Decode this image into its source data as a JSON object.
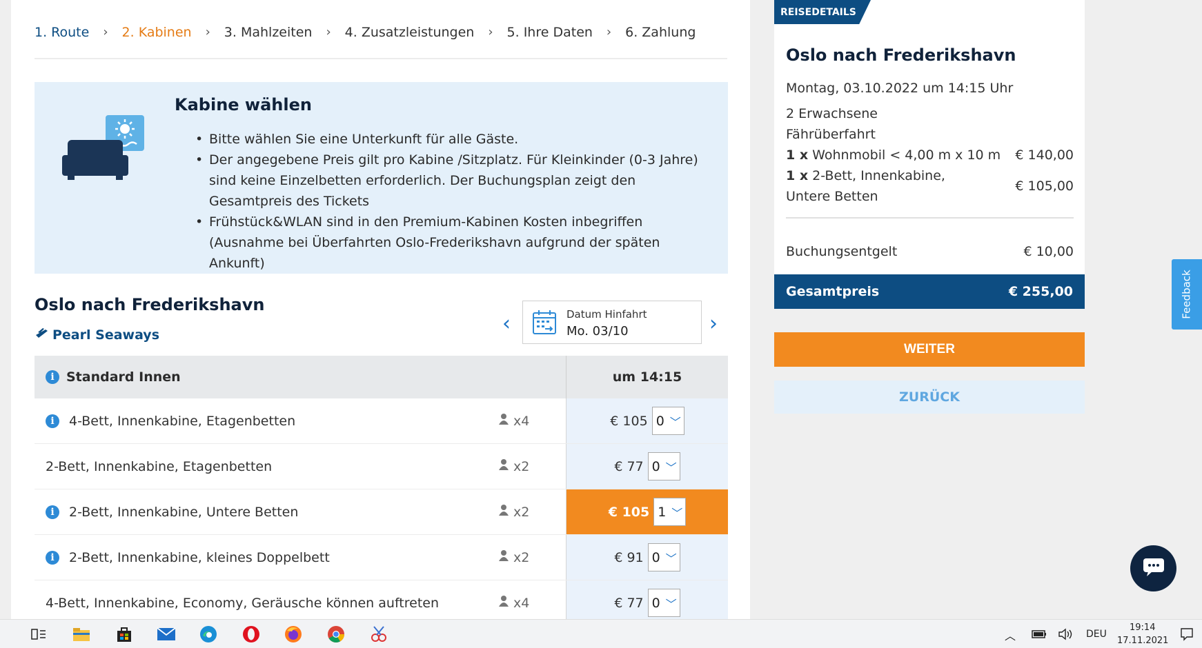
{
  "breadcrumb": [
    "1. Route",
    "2. Kabinen",
    "3. Mahlzeiten",
    "4. Zusatzleistungen",
    "5. Ihre Daten",
    "6. Zahlung"
  ],
  "info": {
    "title": "Kabine wählen",
    "bullets": [
      "Bitte wählen Sie eine Unterkunft für alle Gäste.",
      "Der angegebene Preis gilt pro Kabine /Sitzplatz. Für Kleinkinder (0-3 Jahre) sind keine Einzelbetten erforderlich. Der Buchungsplan zeigt den Gesamtpreis des Tickets",
      "Frühstück&WLAN sind in den Premium-Kabinen Kosten inbegriffen (Ausnahme bei Überfahrten Oslo-Frederikshavn aufgrund der späten Ankunft)"
    ]
  },
  "route": {
    "title": "Oslo nach Frederikshavn",
    "ship": "Pearl Seaways",
    "date_label": "Datum Hinfahrt",
    "date_value": "Mo. 03/10"
  },
  "table": {
    "category": "Standard Innen",
    "time": "um 14:15",
    "rows": [
      {
        "name": "4-Bett, Innenkabine, Etagenbetten",
        "info": true,
        "persons": "x4",
        "price": "€ 105",
        "qty": "0",
        "selected": false
      },
      {
        "name": "2-Bett, Innenkabine, Etagenbetten",
        "info": false,
        "persons": "x2",
        "price": "€ 77",
        "qty": "0",
        "selected": false
      },
      {
        "name": "2-Bett, Innenkabine, Untere Betten",
        "info": true,
        "persons": "x2",
        "price": "€ 105",
        "qty": "1",
        "selected": true
      },
      {
        "name": "2-Bett, Innenkabine, kleines Doppelbett",
        "info": true,
        "persons": "x2",
        "price": "€ 91",
        "qty": "0",
        "selected": false
      },
      {
        "name": "4-Bett, Innenkabine, Economy, Geräusche können auftreten",
        "info": false,
        "persons": "x4",
        "price": "€ 77",
        "qty": "0",
        "selected": false
      }
    ]
  },
  "details": {
    "tab": "REISEDETAILS",
    "title": "Oslo nach Frederikshavn",
    "date": "Montag, 03.10.2022 um 14:15 Uhr",
    "passengers": "2 Erwachsene",
    "crossing": "Fährüberfahrt",
    "item1_qty": "1 x",
    "item1_name": "Wohnmobil < 4,00 m x 10 m",
    "item1_price": "€ 140,00",
    "item2_qty": "1 x",
    "item2_name": "2-Bett, Innenkabine, Untere Betten",
    "item2_price": "€ 105,00",
    "fee_label": "Buchungsentgelt",
    "fee_value": "€ 10,00",
    "total_label": "Gesamtpreis",
    "total_value": "€ 255,00",
    "next_label": "WEITER",
    "back_label": "ZURÜCK"
  },
  "feedback_label": "Feedback",
  "taskbar": {
    "lang": "DEU",
    "time": "19:14",
    "date": "17.11.2021"
  },
  "colors": {
    "brand_blue": "#0d4d82",
    "accent_orange": "#f28a1f",
    "info_bg": "#e4f0fa"
  }
}
